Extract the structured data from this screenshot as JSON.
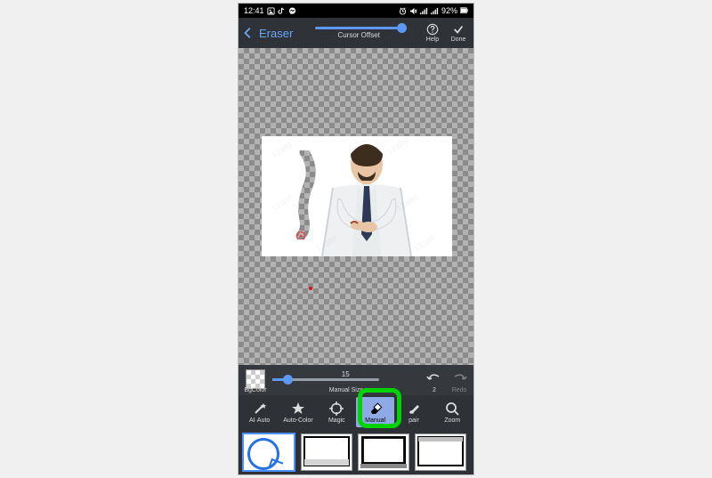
{
  "status": {
    "time": "12:41",
    "battery": "92%"
  },
  "toolbar": {
    "title": "Eraser",
    "cursor_offset_label": "Cursor Offset",
    "help_label": "Help",
    "done_label": "Done"
  },
  "mid": {
    "bgcolor_label": "BgColor",
    "size_value": "15",
    "size_label": "Manual Size",
    "undo_count": "2",
    "redo_label": "Redo"
  },
  "tools": {
    "ai_auto": "AI·Auto",
    "auto_color": "Auto-Color",
    "magic": "Magic",
    "manual": "Manual",
    "repair": "pair",
    "zoom": "Zoom"
  }
}
